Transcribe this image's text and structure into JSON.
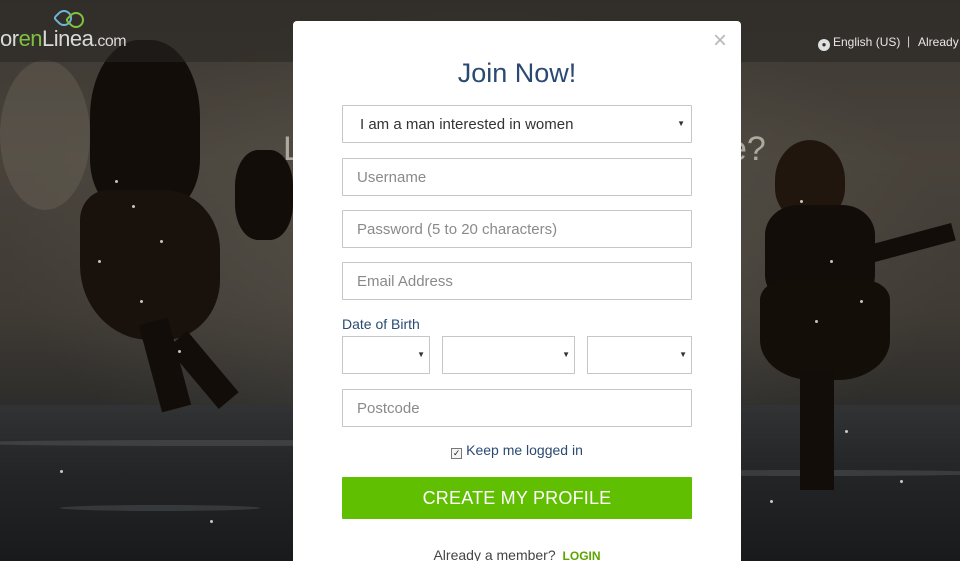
{
  "site": {
    "logo": {
      "text_start": "or",
      "text_accent": "en",
      "text_end": "Linea",
      "suffix": ".com"
    },
    "language": "English (US)",
    "separator": "|",
    "already_member_link": "Already",
    "headline_left": "L",
    "headline_right": "e?"
  },
  "modal": {
    "title": "Join Now!",
    "close_glyph": "×",
    "orientation": {
      "selected": "I am a man interested in women"
    },
    "username": {
      "placeholder": "Username"
    },
    "password": {
      "placeholder": "Password (5 to 20 characters)"
    },
    "email": {
      "placeholder": "Email Address"
    },
    "dob": {
      "label": "Date of Birth",
      "day": "",
      "month": "",
      "year": ""
    },
    "postcode": {
      "placeholder": "Postcode"
    },
    "remember": {
      "label": "Keep me logged in",
      "checked": true
    },
    "submit_label": "CREATE MY PROFILE",
    "footer": {
      "text": "Already a member?",
      "login_label": "LOGIN"
    }
  },
  "colors": {
    "title": "#2a4a72",
    "cta": "#5fbf00",
    "login_link": "#5aa500",
    "logo_accent": "#7fc241"
  },
  "icons": {
    "close": "close-icon",
    "caret": "chevron-down-icon",
    "globe": "globe-icon",
    "checkbox": "checkbox-icon",
    "hearts": "logo-hearts-icon"
  }
}
